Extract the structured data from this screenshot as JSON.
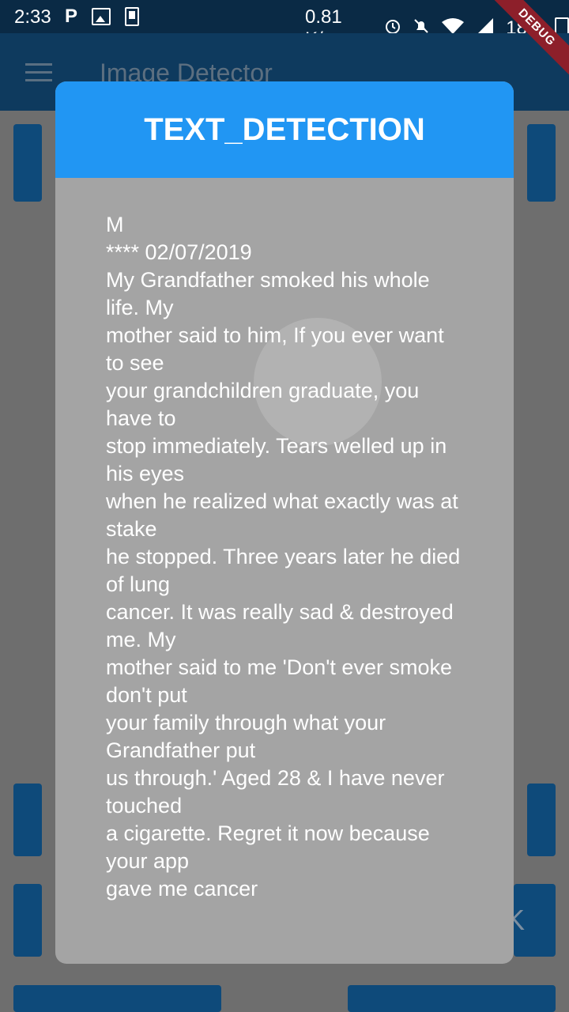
{
  "status_bar": {
    "time": "2:33",
    "net_speed": "0.81 K/s",
    "battery_percent": "18%",
    "icons": [
      "p-icon",
      "image-icon",
      "download-icon",
      "alarm-icon",
      "mute-icon",
      "wifi-icon",
      "signal-icon",
      "battery-icon"
    ]
  },
  "debug_banner": "DEBUG",
  "app_bar": {
    "title": "Image Detector",
    "menu_icon": "menu-icon"
  },
  "background": {
    "partial_button_glyph": "K"
  },
  "dialog": {
    "title": "TEXT_DETECTION",
    "body": "M\n**** 02/07/2019\nMy Grandfather smoked his whole life. My\nmother said to him, If you ever want to see\nyour grandchildren graduate, you have to\nstop immediately. Tears welled up in his eyes\nwhen he realized what exactly was at stake\nhe stopped. Three years later he died of lung\ncancer. It was really sad & destroyed me. My\nmother said to me 'Don't ever smoke don't put\nyour family through what your Grandfather put\nus through.' Aged 28 & I have never touched\na cigarette. Regret it now because your app\ngave me cancer"
  },
  "colors": {
    "dialog_header": "#2196f3",
    "dialog_body": "#a4a4a4",
    "app_bar": "#0e3a5e",
    "status_bar": "#0a2a45",
    "debug_ribbon": "#8d1f2a"
  }
}
